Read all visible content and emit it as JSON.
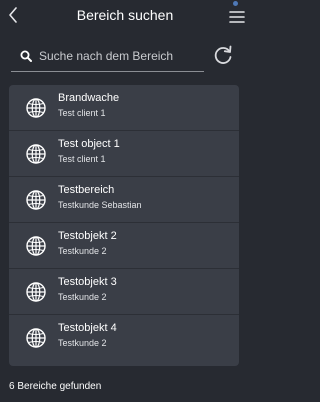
{
  "header": {
    "title": "Bereich suchen",
    "back_icon": "chevron-left-icon",
    "menu_icon": "hamburger-menu-icon"
  },
  "search": {
    "placeholder": "Suche nach dem Bereich",
    "value": ""
  },
  "areas": [
    {
      "name": "Brandwache",
      "client": "Test client 1"
    },
    {
      "name": "Test object 1",
      "client": "Test client 1"
    },
    {
      "name": "Testbereich",
      "client": "Testkunde Sebastian"
    },
    {
      "name": "Testobjekt 2",
      "client": "Testkunde 2"
    },
    {
      "name": "Testobjekt 3",
      "client": "Testkunde 2"
    },
    {
      "name": "Testobjekt 4",
      "client": "Testkunde 2"
    }
  ],
  "footer": {
    "result_count": "6 Bereiche gefunden"
  },
  "colors": {
    "background": "#272a31",
    "list_background": "#3a3e47",
    "accent_dot": "#4f79b7"
  }
}
